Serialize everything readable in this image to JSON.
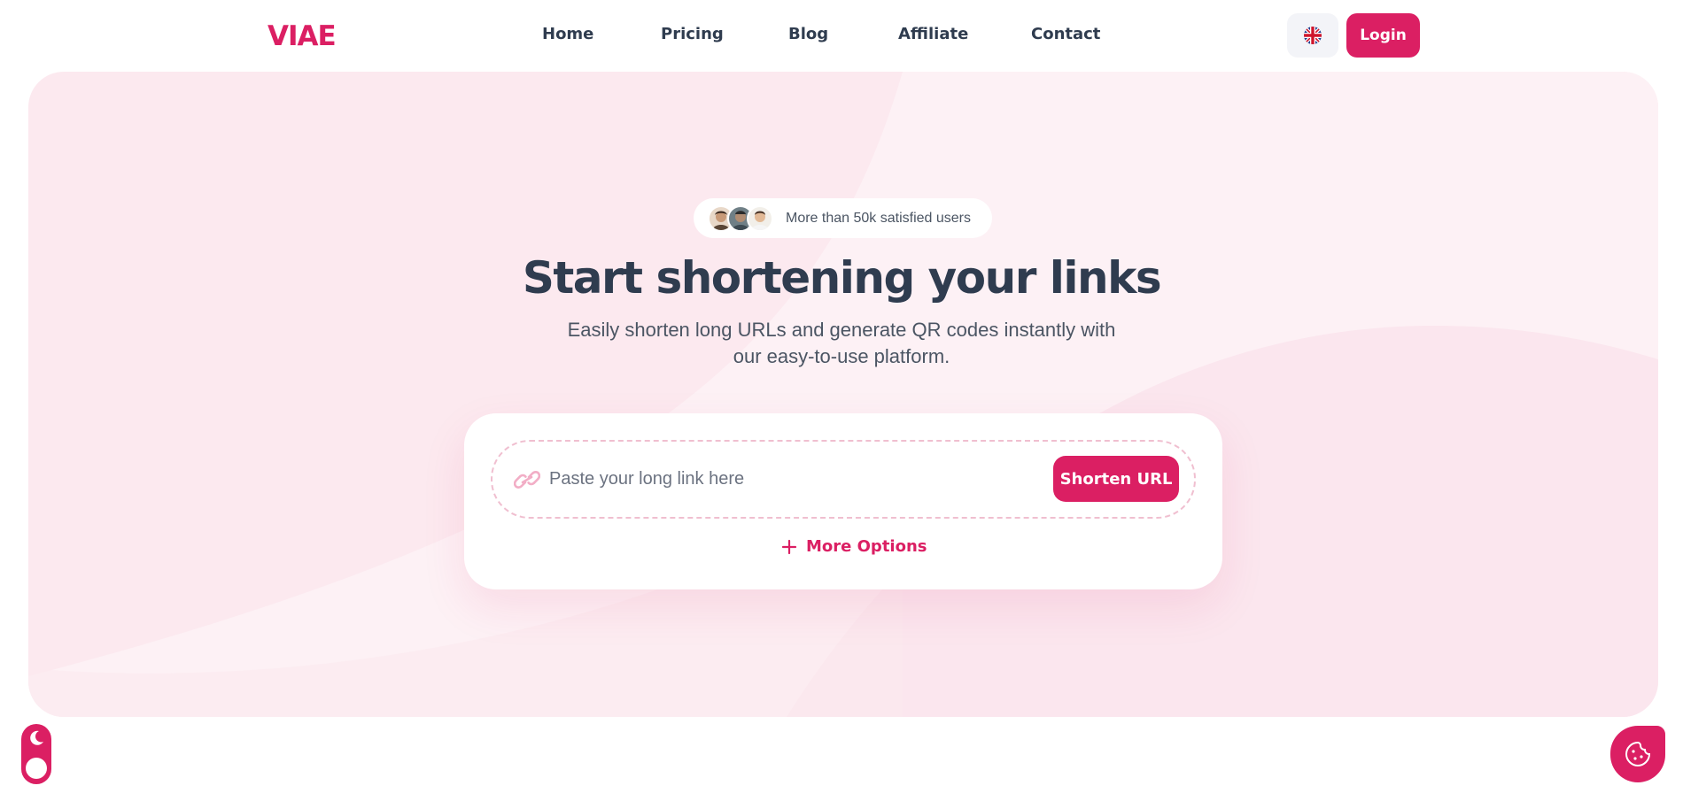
{
  "header": {
    "logo": "VIAE",
    "nav": [
      {
        "label": "Home"
      },
      {
        "label": "Pricing"
      },
      {
        "label": "Blog"
      },
      {
        "label": "Affiliate"
      },
      {
        "label": "Contact"
      }
    ],
    "language_icon": "uk-flag-icon",
    "login_label": "Login"
  },
  "hero": {
    "social_proof": "More than 50k satisfied users",
    "title": "Start shortening your links",
    "subtitle": "Easily shorten long URLs and generate QR codes instantly with our easy-to-use platform.",
    "input_placeholder": "Paste your long link here",
    "input_value": "",
    "shorten_label": "Shorten URL",
    "more_options_label": "More Options"
  },
  "widgets": {
    "theme_toggle_icon": "moon-icon",
    "cookie_icon": "cookie-icon"
  },
  "colors": {
    "accent": "#db1f63",
    "hero_background": "#fce9ef",
    "text_dark": "#2f3c4f"
  }
}
